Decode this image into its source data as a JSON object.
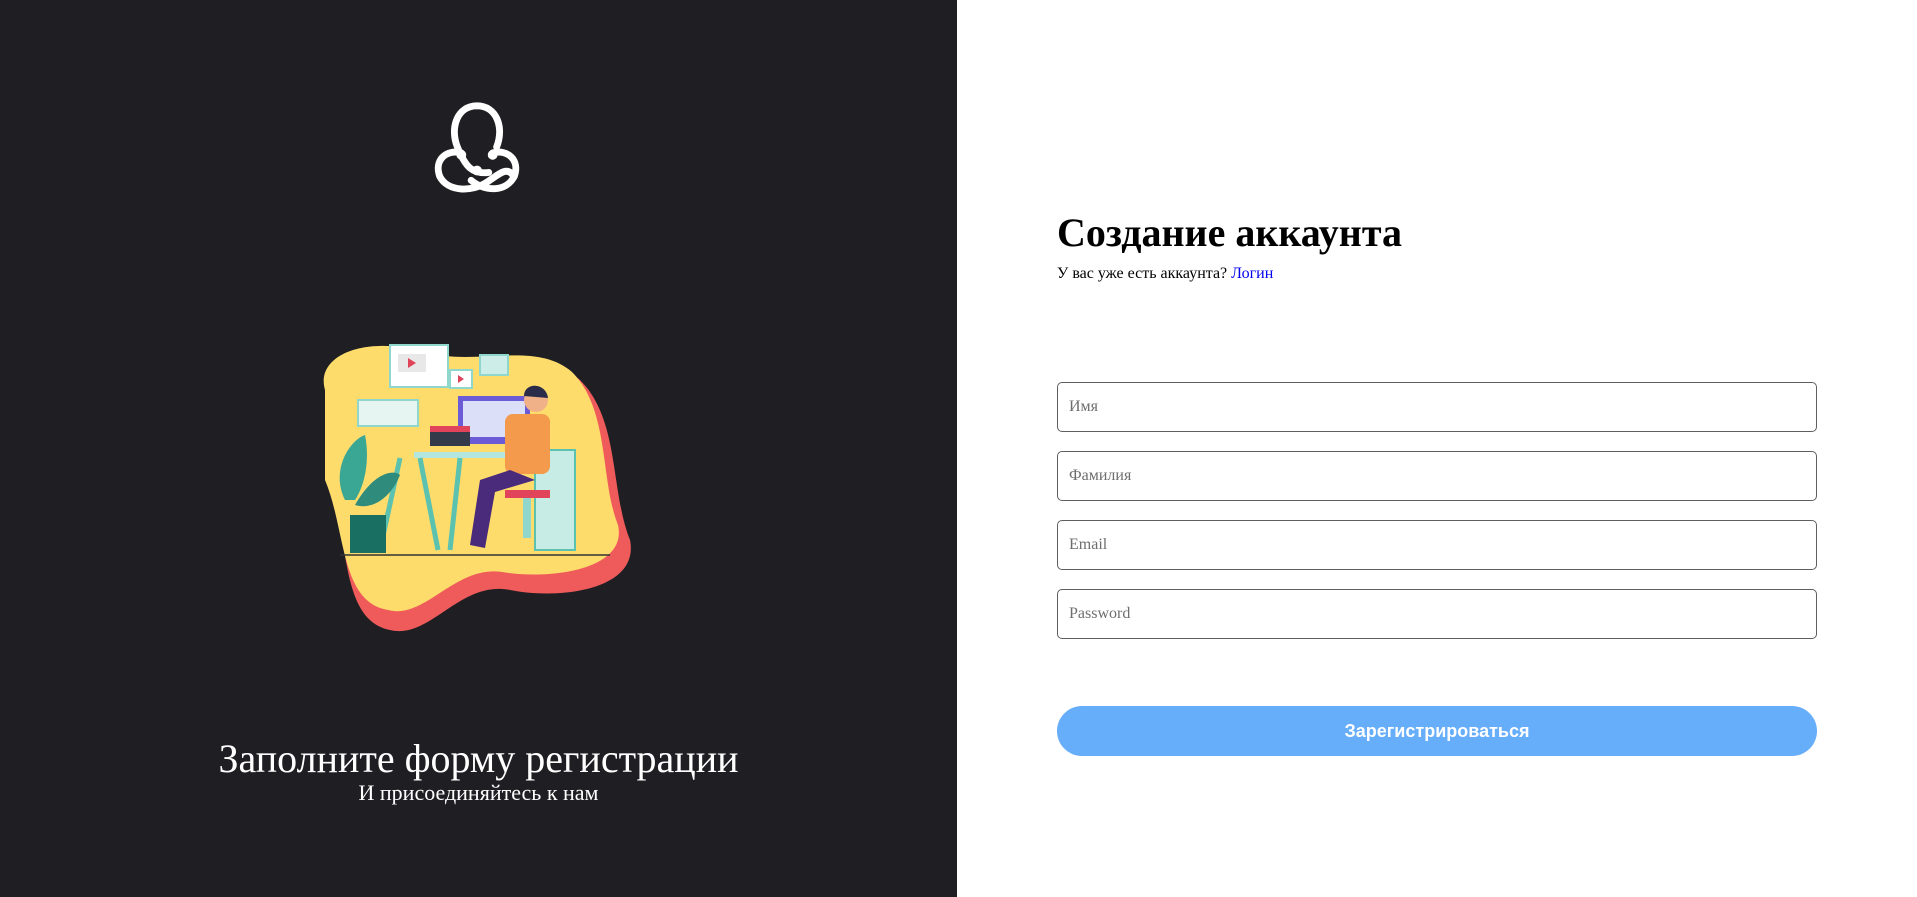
{
  "left_panel": {
    "logo_icon": "redux-logo-icon",
    "illustration": "person-at-desk-illustration",
    "title": "Заполните форму регистрации",
    "subtitle": "И присоединяйтесь к нам"
  },
  "form": {
    "title": "Создание аккаунта",
    "have_account_text": "У вас уже есть аккаунта?",
    "login_link": "Логин",
    "fields": {
      "first_name": {
        "placeholder": "Имя",
        "value": ""
      },
      "last_name": {
        "placeholder": "Фамилия",
        "value": ""
      },
      "email": {
        "placeholder": "Email",
        "value": ""
      },
      "password": {
        "placeholder": "Password",
        "value": ""
      }
    },
    "submit_label": "Зарегистрироваться"
  },
  "colors": {
    "left_bg": "#1f1f23",
    "button_bg": "#66adfa",
    "link": "#0000ee"
  }
}
